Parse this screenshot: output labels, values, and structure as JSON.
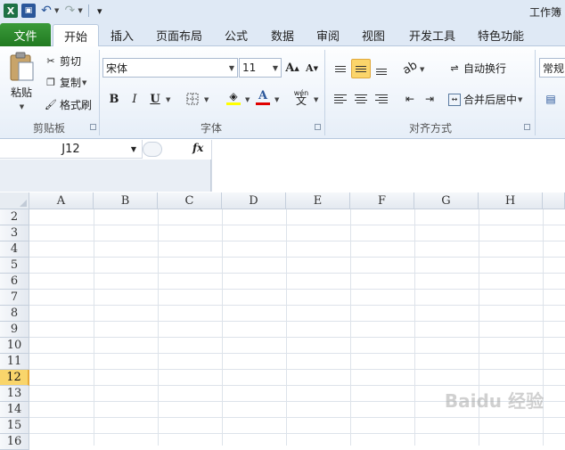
{
  "window": {
    "title": "工作簿"
  },
  "quick_access": {
    "items": [
      {
        "icon": "excel-logo-icon",
        "glyph": "X"
      },
      {
        "icon": "save-icon",
        "glyph": "▣"
      },
      {
        "icon": "undo-icon",
        "glyph": "↶"
      },
      {
        "icon": "redo-icon",
        "glyph": "↷"
      },
      {
        "icon": "customize-qat-icon",
        "glyph": "▾"
      }
    ]
  },
  "tabs": [
    {
      "label": "文件"
    },
    {
      "label": "开始"
    },
    {
      "label": "插入"
    },
    {
      "label": "页面布局"
    },
    {
      "label": "公式"
    },
    {
      "label": "数据"
    },
    {
      "label": "审阅"
    },
    {
      "label": "视图"
    },
    {
      "label": "开发工具"
    },
    {
      "label": "特色功能"
    }
  ],
  "clipboard": {
    "paste": "粘贴",
    "cut": "剪切",
    "copy": "复制",
    "format_painter": "格式刷",
    "group_label": "剪贴板"
  },
  "font": {
    "name": "宋体",
    "size": "11",
    "bold": "B",
    "italic": "I",
    "underline": "U",
    "grow": "A",
    "shrink": "A",
    "font_color": "A",
    "phonetic": "wén",
    "group_label": "字体"
  },
  "alignment": {
    "wrap_text": "自动换行",
    "merge_center": "合并后居中",
    "group_label": "对齐方式"
  },
  "number": {
    "format": "常规"
  },
  "formula_bar": {
    "name_box": "J12",
    "fx": "fx",
    "content": ""
  },
  "grid": {
    "columns": [
      "A",
      "B",
      "C",
      "D",
      "E",
      "F",
      "G",
      "H"
    ],
    "rows": [
      "2",
      "3",
      "4",
      "5",
      "6",
      "7",
      "8",
      "9",
      "10",
      "11",
      "12",
      "13",
      "14",
      "15",
      "16"
    ],
    "selected_row": "12"
  },
  "watermark": "Baidu 经验",
  "colors": {
    "file_tab": "#2a8a2a",
    "selected_header": "#f9d56b",
    "ribbon_bg": "#eef3fa"
  }
}
